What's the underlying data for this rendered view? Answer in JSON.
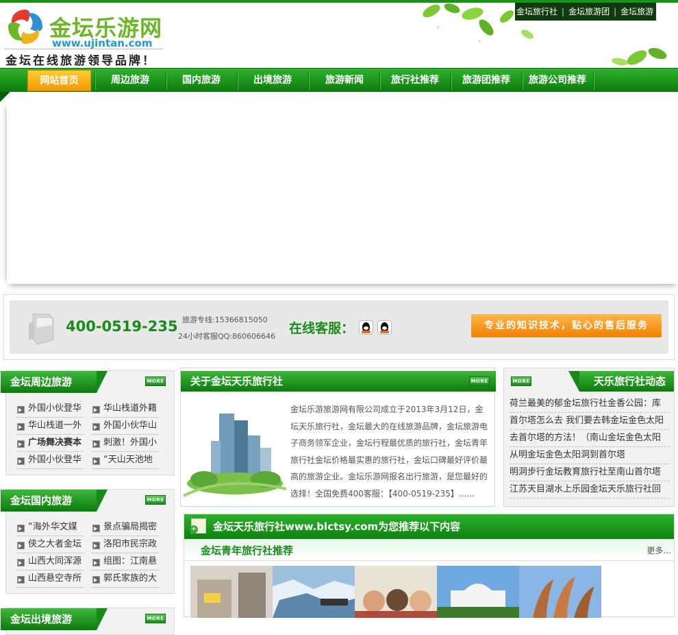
{
  "header": {
    "logo_name": "金坛乐游网",
    "logo_url": "www.ujintan.com",
    "slogan": "金坛在线旅游领导品牌！",
    "top_links": [
      "金坛旅行社",
      "金坛旅游团",
      "金坛旅游"
    ]
  },
  "nav": {
    "items": [
      "网站首页",
      "周边旅游",
      "国内旅游",
      "出境旅游",
      "旅游新闻",
      "旅行社推荐",
      "旅游团推荐",
      "旅游公司推荐"
    ],
    "active_index": 0
  },
  "contact": {
    "hotline": "400-0519-235",
    "line1": "旅游专线:15366815050",
    "line2": "24小时客服QQ:860606646",
    "online_service": "在线客服：",
    "service_banner": "专业的知识技术，贴心的售后服务"
  },
  "more_label": "MORE",
  "sections": [
    {
      "title": "金坛周边旅游",
      "items": [
        "外国小伙登华",
        "华山栈道外籍",
        "华山栈道一外",
        "外国小伙华山",
        "广场舞决赛本",
        "刺激！外国小",
        "外国小伙登华",
        "“天山天池地"
      ]
    },
    {
      "title": "金坛国内旅游",
      "items": [
        "“海外华文媒",
        "景点骗局揭密",
        "侠之大者金坛",
        "洛阳市民宗政",
        "山西大同浑源",
        "组图：江南悬",
        "山西悬空寺所",
        "郭氏家族的大"
      ]
    },
    {
      "title": "金坛出境旅游",
      "items": []
    }
  ],
  "about": {
    "title": "关于金坛天乐旅行社",
    "text": "金坛乐游旅游网有限公司成立于2013年3月12日，金坛天乐旅行社，金坛最大的在线旅游品牌，金坛旅游电子商务领军企业，金坛行程最优质的旅行社，金坛青年旅行社金坛价格最实惠的旅行社，金坛口碑最好评价最高的旅游企业。金坛乐游网报名出行旅游，是您最好的选择！全国免费400客服：【400-0519-235】......"
  },
  "news": {
    "title": "天乐旅行社动态",
    "items": [
      "荷兰最美的郁金坛旅行社金香公园：库",
      "首尔塔怎么去 我们要去韩金坛金色太阳",
      "去首尔塔的方法！（南山金坛金色太阳",
      "从明金坛金色太阳洞到首尔塔",
      "明洞步行金坛教育旅行社至南山首尔塔",
      "江苏天目湖水上乐园金坛天乐旅行社回"
    ]
  },
  "recommend": {
    "title": "金坛天乐旅行社www.blctsy.com为您推荐以下内容",
    "subtitle": "金坛青年旅行社推荐",
    "more": "更多..."
  }
}
